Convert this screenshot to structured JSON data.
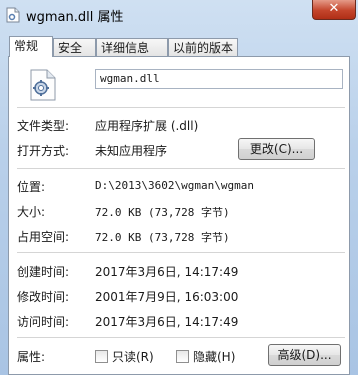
{
  "window": {
    "title": "wgman.dll 属性",
    "close_glyph": "✕"
  },
  "tabs": [
    {
      "label": "常规"
    },
    {
      "label": "安全"
    },
    {
      "label": "详细信息"
    },
    {
      "label": "以前的版本"
    }
  ],
  "general": {
    "file_name": "wgman.dll",
    "file_type_label": "文件类型:",
    "file_type_value": "应用程序扩展 (.dll)",
    "open_with_label": "打开方式:",
    "open_with_value": "未知应用程序",
    "change_button": "更改(C)...",
    "location_label": "位置:",
    "location_value": "D:\\2013\\3602\\wgman\\wgman",
    "size_label": "大小:",
    "size_value": "72.0 KB (73,728 字节)",
    "disk_size_label": "占用空间:",
    "disk_size_value": "72.0 KB (73,728 字节)",
    "created_label": "创建时间:",
    "created_value": "2017年3月6日, 14:17:49",
    "modified_label": "修改时间:",
    "modified_value": "2001年7月9日, 16:03:00",
    "accessed_label": "访问时间:",
    "accessed_value": "2017年3月6日, 14:17:49",
    "attributes_label": "属性:",
    "readonly_label": "只读(R)",
    "hidden_label": "隐藏(H)",
    "advanced_button": "高级(D)..."
  }
}
